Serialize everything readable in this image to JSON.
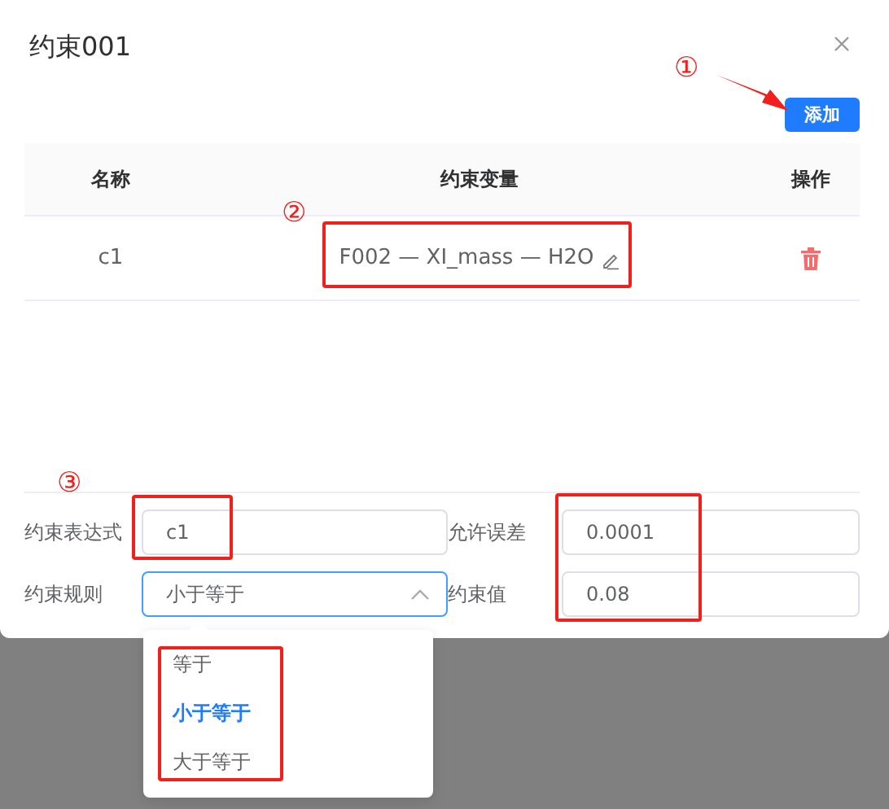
{
  "dialog": {
    "title": "约束001"
  },
  "add_button": "添加",
  "table": {
    "columns": [
      "名称",
      "约束变量",
      "操作"
    ],
    "rows": [
      {
        "name": "c1",
        "variable": "F002 — XI_mass — H2O"
      }
    ]
  },
  "form": {
    "fields": [
      {
        "label": "约束表达式",
        "value": "c1",
        "kind": "input"
      },
      {
        "label": "允许误差",
        "value": "0.0001",
        "kind": "input"
      },
      {
        "label": "约束规则",
        "value": "小于等于",
        "kind": "select",
        "expanded": true
      },
      {
        "label": "约束值",
        "value": "0.08",
        "kind": "input"
      }
    ]
  },
  "dropdown": {
    "options": [
      {
        "label": "等于",
        "selected": false
      },
      {
        "label": "小于等于",
        "selected": true
      },
      {
        "label": "大于等于",
        "selected": false
      }
    ]
  },
  "annotations": [
    {
      "number": "①"
    },
    {
      "number": "②"
    },
    {
      "number": "③"
    }
  ]
}
